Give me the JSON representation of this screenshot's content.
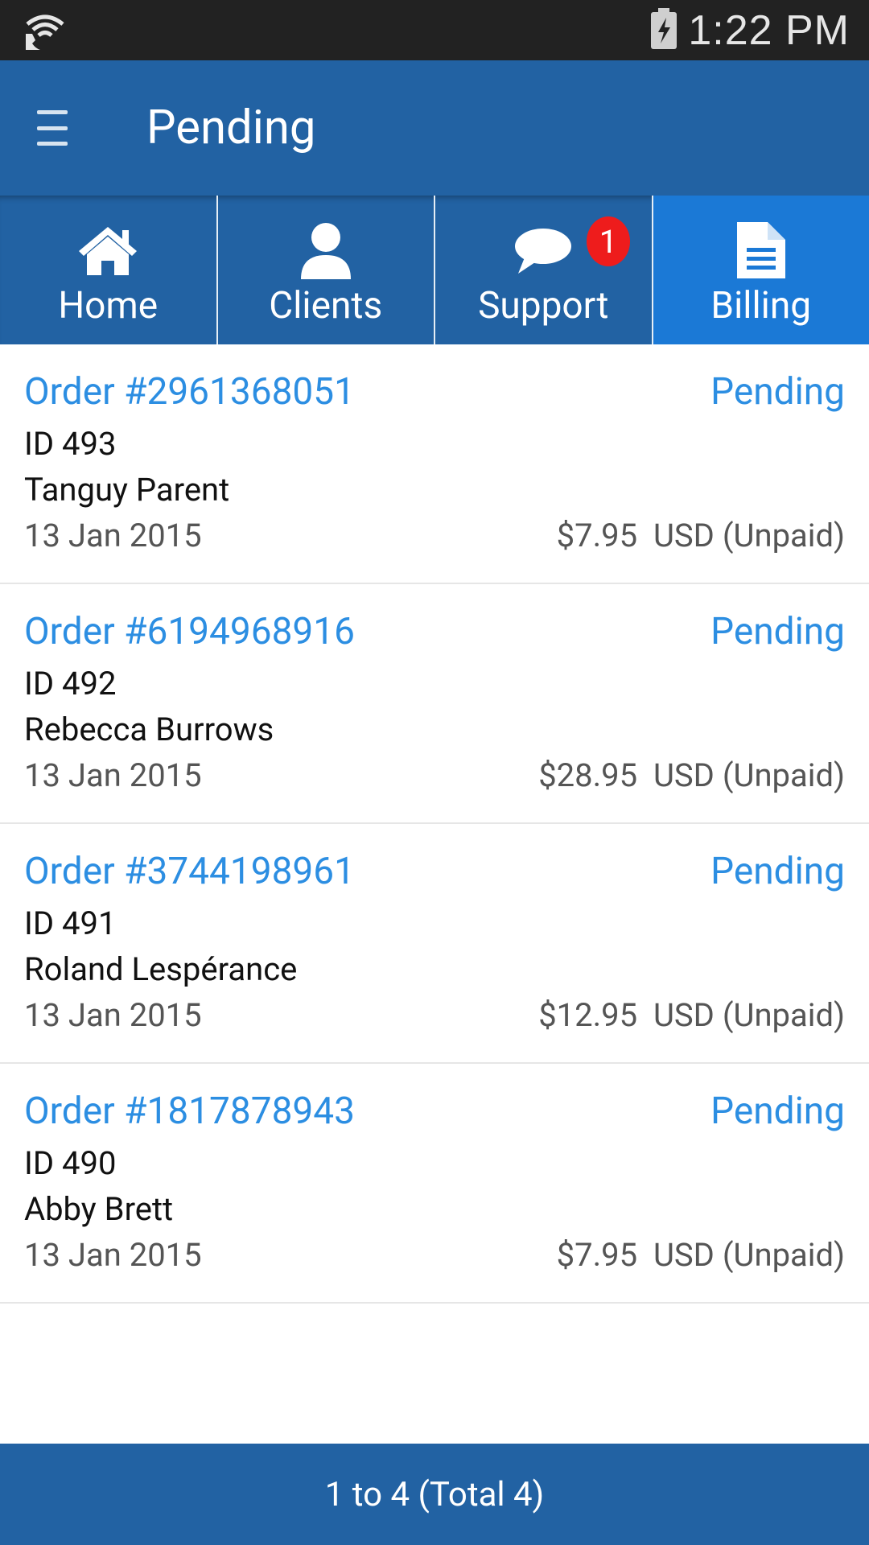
{
  "status_bar": {
    "time": "1:22 PM",
    "icons": [
      "wifi-call-icon",
      "battery-charging-icon"
    ]
  },
  "app_bar": {
    "title": "Pending",
    "menu_icon": "hamburger-menu-icon"
  },
  "tabs": [
    {
      "label": "Home",
      "icon": "home-icon",
      "active": false
    },
    {
      "label": "Clients",
      "icon": "user-icon",
      "active": false
    },
    {
      "label": "Support",
      "icon": "chat-bubble-icon",
      "active": false,
      "badge": "1"
    },
    {
      "label": "Billing",
      "icon": "document-icon",
      "active": true
    }
  ],
  "orders": [
    {
      "number": "Order #2961368051",
      "status": "Pending",
      "id": "ID 493",
      "client": "Tanguy Parent",
      "date": "13 Jan 2015",
      "amount": "$7.95  USD (Unpaid)"
    },
    {
      "number": "Order #6194968916",
      "status": "Pending",
      "id": "ID 492",
      "client": "Rebecca Burrows",
      "date": "13 Jan 2015",
      "amount": "$28.95  USD (Unpaid)"
    },
    {
      "number": "Order #3744198961",
      "status": "Pending",
      "id": "ID 491",
      "client": "Roland Lespérance",
      "date": "13 Jan 2015",
      "amount": "$12.95  USD (Unpaid)"
    },
    {
      "number": "Order #1817878943",
      "status": "Pending",
      "id": "ID 490",
      "client": "Abby Brett",
      "date": "13 Jan 2015",
      "amount": "$7.95  USD (Unpaid)"
    }
  ],
  "footer": {
    "pagination": "1 to 4 (Total 4)"
  },
  "colors": {
    "primary": "#2262a3",
    "active_tab": "#1b79d6",
    "link": "#2c8ee2",
    "badge": "#ee1c1c",
    "status_bar": "#222222"
  }
}
